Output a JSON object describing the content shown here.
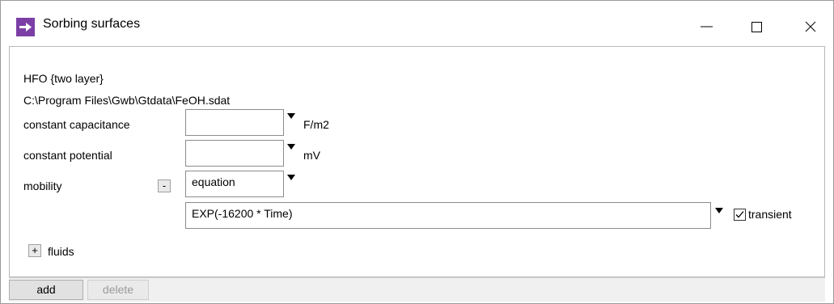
{
  "window": {
    "title": "Sorbing surfaces",
    "icon": "purple-arrow-icon",
    "accent": "#7b3fa6"
  },
  "surface": {
    "name": "HFO {two layer}",
    "path": "C:\\Program Files\\Gwb\\Gtdata\\FeOH.sdat"
  },
  "rows": {
    "capacitance": {
      "label": "constant capacitance",
      "value": "",
      "unit": "F/m2"
    },
    "potential": {
      "label": "constant potential",
      "value": "",
      "unit": "mV"
    },
    "mobility": {
      "label": "mobility",
      "toggle": "-",
      "type": "equation",
      "expression": "EXP(-16200 * Time)",
      "transient_label": "transient",
      "transient_checked": true
    }
  },
  "fluids": {
    "toggle": "+",
    "label": "fluids"
  },
  "buttons": {
    "add": "add",
    "delete": "delete"
  }
}
